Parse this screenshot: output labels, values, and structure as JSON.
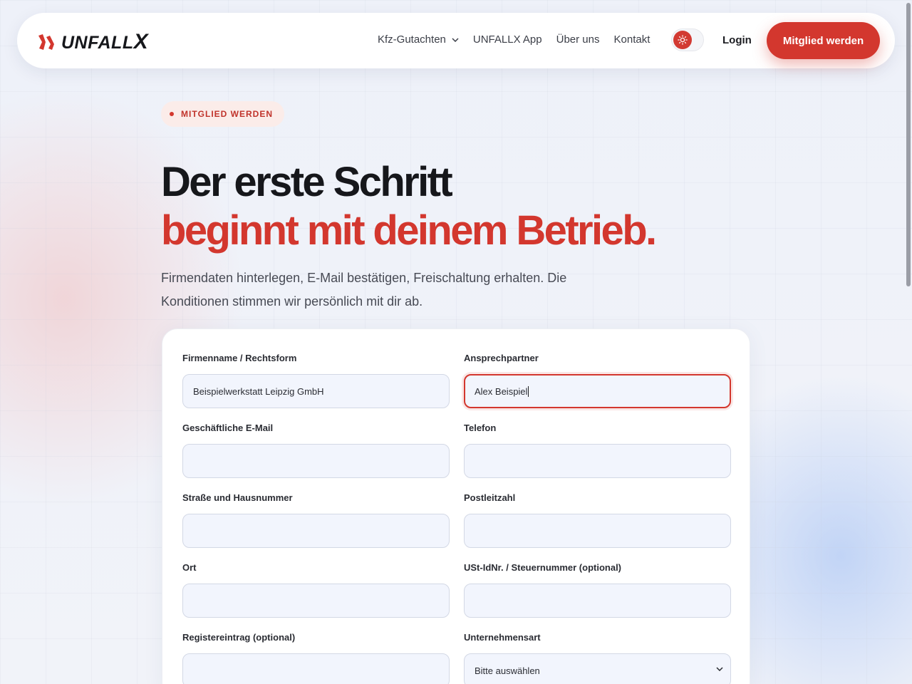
{
  "brand": {
    "name": "UNFALL",
    "name_x": "X"
  },
  "nav": {
    "links": [
      {
        "label": "Kfz-Gutachten",
        "has_dropdown": true
      },
      {
        "label": "UNFALLX App"
      },
      {
        "label": "Über uns"
      },
      {
        "label": "Kontakt"
      }
    ],
    "theme_toggle": {
      "icon": "sun-icon",
      "state": "light"
    },
    "login_label": "Login",
    "cta_label": "Mitglied werden"
  },
  "hero": {
    "badge": "MITGLIED WERDEN",
    "headline_1": "Der erste Schritt",
    "headline_2": "beginnt mit deinem Betrieb.",
    "lead": "Firmendaten hinterlegen, E-Mail bestätigen, Freischaltung erhalten. Die Konditionen stimmen wir persönlich mit dir ab."
  },
  "form": {
    "fields": [
      {
        "label": "Firmenname / Rechtsform",
        "value": "Beispielwerkstatt Leipzig GmbH"
      },
      {
        "label": "Ansprechpartner",
        "value": "Alex Beispiel",
        "focused": true
      },
      {
        "label": "Geschäftliche E-Mail",
        "value": ""
      },
      {
        "label": "Telefon",
        "value": ""
      },
      {
        "label": "Straße und Hausnummer",
        "value": ""
      },
      {
        "label": "Postleitzahl",
        "value": ""
      },
      {
        "label": "Ort",
        "value": ""
      },
      {
        "label": "USt-IdNr. / Steuernummer (optional)",
        "value": ""
      },
      {
        "label": "Registereintrag (optional)",
        "value": ""
      },
      {
        "label": "Unternehmensart",
        "value": "Bitte auswählen",
        "type": "select"
      }
    ]
  },
  "colors": {
    "accent": "#d3372e",
    "text": "#16171b",
    "input_bg": "#f2f5fd"
  }
}
